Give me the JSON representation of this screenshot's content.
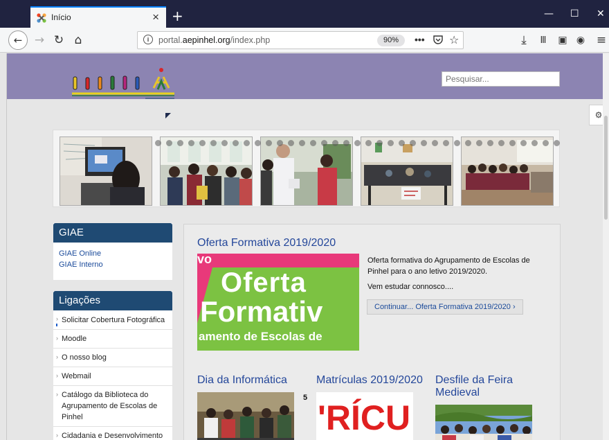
{
  "browser": {
    "tab_title": "Início",
    "close_glyph": "×",
    "new_tab_glyph": "+",
    "url_prefix": "portal.",
    "url_domain": "aepinhel.org",
    "url_path": "/index.php",
    "zoom": "90%",
    "more_glyph": "•••",
    "star_glyph": "☆",
    "min_glyph": "—",
    "max_glyph": "☐",
    "winclose_glyph": "✕",
    "back_glyph": "←",
    "forward_glyph": "→",
    "reload_glyph": "↻",
    "home_glyph": "⌂",
    "download_glyph": "⤓",
    "library_glyph": "Ⅲ",
    "sidebar_glyph": "▣",
    "account_glyph": "◉",
    "menu_glyph": "≡",
    "accent_color": "#0a84ff"
  },
  "header": {
    "search_placeholder": "Pesquisar...",
    "header_color": "#8c84b2"
  },
  "giae": {
    "title": "GIAE",
    "links": [
      "GIAE Online",
      "GIAE Interno"
    ]
  },
  "ligacoes": {
    "title": "Ligações",
    "items": [
      "Solicitar Cobertura Fotográfica",
      "Moodle",
      "O nosso blog",
      "Webmail",
      "Catálogo da Biblioteca do Agrupamento de Escolas de Pinhel",
      "Cidadania e Desenvolvimento"
    ]
  },
  "main": {
    "featured": {
      "title": "Oferta Formativa 2019/2020",
      "image_line1": "Oferta",
      "image_line2": "Formativ",
      "image_line3": "amento de Escolas de",
      "image_corner": "vo",
      "intro_p1": "Oferta formativa do Agrupamento de Escolas de Pinhel para o ano letivo 2019/2020.",
      "intro_p2": "Vem estudar connosco....",
      "read_more": "Continuar... Oferta Formativa 2019/2020 ›"
    },
    "articles": [
      {
        "title": "Dia da Informática"
      },
      {
        "title": "Matrículas 2019/2020",
        "image_text": "'RÍCU"
      },
      {
        "title": "Desfile da Feira Medieval"
      }
    ],
    "side_number": "5"
  }
}
